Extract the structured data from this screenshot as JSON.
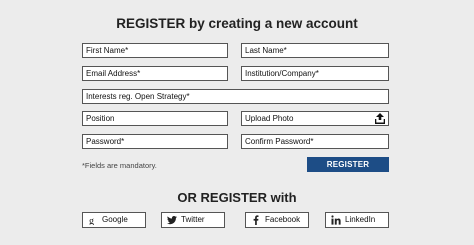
{
  "heading": "REGISTER by creating a new account",
  "fields": {
    "first_name": "First Name*",
    "last_name": "Last Name*",
    "email": "Email Address*",
    "institution": "Institution/Company*",
    "interests": "Interests reg. Open Strategy*",
    "position": "Position",
    "upload_photo": "Upload Photo",
    "password": "Password*",
    "confirm_password": "Confirm Password*"
  },
  "mandatory_note": "*Fields are mandatory.",
  "register_button": "REGISTER",
  "or_heading": "OR REGISTER with",
  "social": {
    "google": "Google",
    "twitter": "Twitter",
    "facebook": "Facebook",
    "linkedin": "LinkedIn"
  },
  "colors": {
    "background": "#ececec",
    "button": "#1d4d86"
  },
  "icons": {
    "upload": "upload-icon",
    "google": "google-icon",
    "twitter": "twitter-icon",
    "facebook": "facebook-icon",
    "linkedin": "linkedin-icon"
  }
}
